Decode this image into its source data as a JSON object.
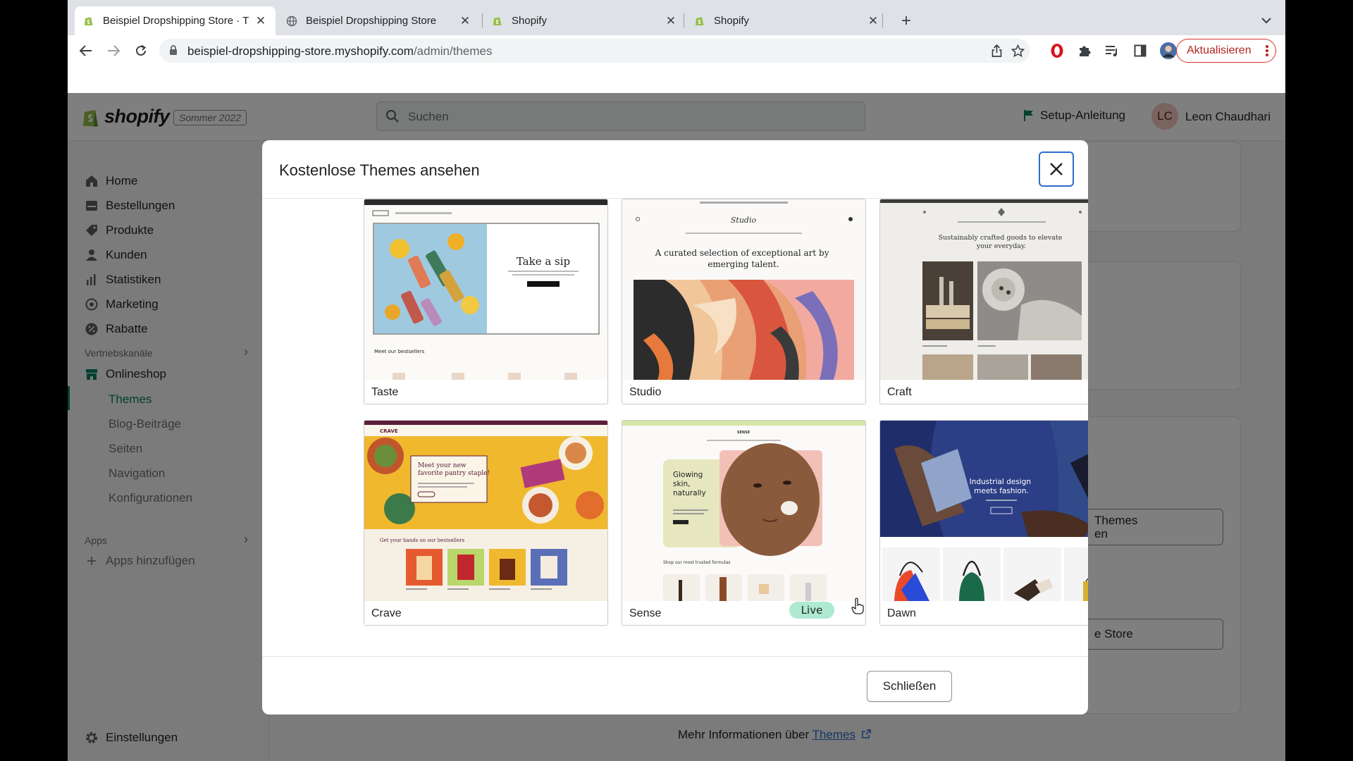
{
  "browser": {
    "tabs": [
      {
        "title": "Beispiel Dropshipping Store · T",
        "favicon": "shopify-icon",
        "active": true
      },
      {
        "title": "Beispiel Dropshipping Store",
        "favicon": "globe-icon",
        "active": false
      },
      {
        "title": "Shopify",
        "favicon": "shopify-icon",
        "active": false
      },
      {
        "title": "Shopify",
        "favicon": "shopify-icon",
        "active": false
      }
    ],
    "url_host": "beispiel-dropshipping-store.myshopify.com",
    "url_path": "/admin/themes",
    "update_label": "Aktualisieren"
  },
  "admin": {
    "brand": "shopify",
    "season_badge": "Sommer 2022",
    "search_placeholder": "Suchen",
    "setup_label": "Setup-Anleitung",
    "user_initials": "LC",
    "user_name": "Leon Chaudhari",
    "nav": {
      "main": [
        {
          "label": "Home",
          "icon": "home-icon"
        },
        {
          "label": "Bestellungen",
          "icon": "orders-icon"
        },
        {
          "label": "Produkte",
          "icon": "tag-icon"
        },
        {
          "label": "Kunden",
          "icon": "person-icon"
        },
        {
          "label": "Statistiken",
          "icon": "bar-chart-icon"
        },
        {
          "label": "Marketing",
          "icon": "target-icon"
        },
        {
          "label": "Rabatte",
          "icon": "discount-icon"
        }
      ],
      "sales_channels_heading": "Vertriebskanäle",
      "online_store": "Onlineshop",
      "online_store_sub": [
        "Themes",
        "Blog-Beiträge",
        "Seiten",
        "Navigation",
        "Konfigurationen"
      ],
      "apps_heading": "Apps",
      "add_apps": "Apps hinzufügen",
      "settings": "Einstellungen"
    },
    "bg_buttons": {
      "themes_partial": "Themes\nen",
      "store_partial": "e Store"
    },
    "footer_prefix": "Mehr Informationen über ",
    "footer_link": "Themes"
  },
  "modal": {
    "title": "Kostenlose Themes ansehen",
    "themes": [
      {
        "name": "Taste",
        "preview_headline": "Take a sip",
        "preview_sub": "Meet our bestsellers"
      },
      {
        "name": "Studio",
        "preview_headline": "A curated selection of exceptional art by emerging talent."
      },
      {
        "name": "Craft",
        "preview_headline": "Sustainably crafted goods to elevate your everyday."
      },
      {
        "name": "Crave",
        "preview_headline": "Meet your new favorite pantry staple!",
        "preview_sub": "Get your hands on our bestsellers"
      },
      {
        "name": "Sense",
        "preview_headline": "Glowing skin, naturally",
        "preview_sub": "Shop our most trusted formulas"
      },
      {
        "name": "Dawn",
        "preview_headline": "Industrial design meets fashion.",
        "badge": "Live"
      }
    ],
    "close_label": "Schließen"
  },
  "colors": {
    "shopify_green": "#008060",
    "live_badge": "#aee9d1",
    "focus_blue": "#2c6ecb",
    "update_red": "#d93025"
  }
}
